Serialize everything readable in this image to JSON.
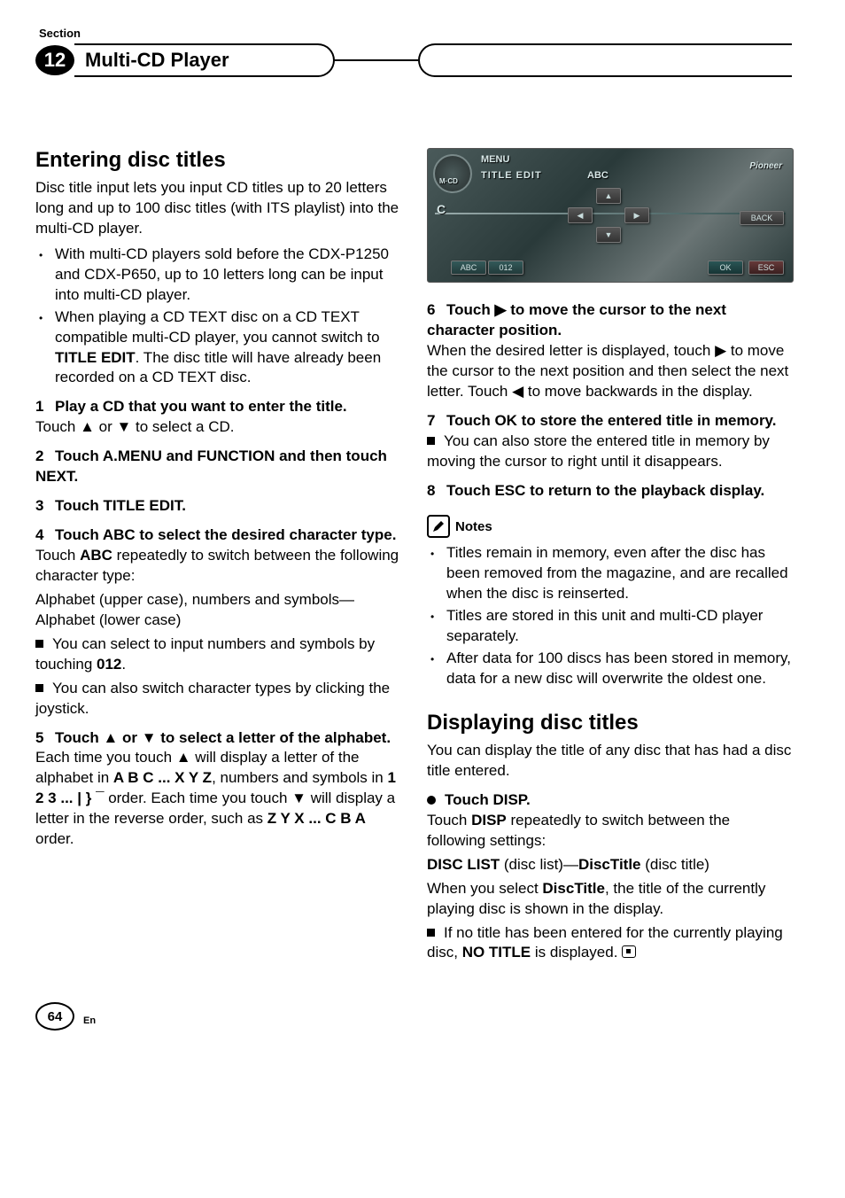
{
  "header": {
    "section_label": "Section",
    "chapter_number": "12",
    "chapter_title": "Multi-CD Player"
  },
  "screenshot": {
    "menu": "MENU",
    "title_edit": "TITLE EDIT",
    "abc_top": "ABC",
    "brand": "Pioneer",
    "text_c": "C",
    "back": "BACK",
    "abc_btn": "ABC",
    "num_btn": "012",
    "ok": "OK",
    "esc": "ESC"
  },
  "left": {
    "h1": "Entering disc titles",
    "intro": "Disc title input lets you input CD titles up to 20 letters long and up to 100 disc titles (with ITS playlist) into the multi-CD player.",
    "bullets": [
      "With multi-CD players sold before the CDX-P1250 and CDX-P650, up to 10 letters long can be input into multi-CD player.",
      ""
    ],
    "bullet2_part1": "When playing a CD TEXT disc on a CD TEXT compatible multi-CD player, you cannot switch to ",
    "bullet2_strong": "TITLE EDIT",
    "bullet2_part2": ". The disc title will have already been recorded on a CD TEXT disc.",
    "step1": "Play a CD that you want to enter the title.",
    "step1_sub": "Touch ▲ or ▼ to select a CD.",
    "step2": "Touch A.MENU and FUNCTION and then touch NEXT.",
    "step3": "Touch TITLE EDIT.",
    "step4": "Touch ABC to select the desired character type.",
    "step4_sub1_a": "Touch ",
    "step4_sub1_b": "ABC",
    "step4_sub1_c": " repeatedly to switch between the following character type:",
    "step4_sub2": "Alphabet (upper case), numbers and symbols—Alphabet (lower case)",
    "step4_note1_a": "You can select to input numbers and symbols by touching ",
    "step4_note1_b": "012",
    "step4_note1_c": ".",
    "step4_note2": "You can also switch character types by clicking the joystick.",
    "step5": "Touch ▲ or ▼ to select a letter of the alphabet.",
    "step5_sub_a": "Each time you touch ▲ will display a letter of the alphabet in ",
    "step5_sub_b": "A B C ... X Y Z",
    "step5_sub_c": ", numbers and symbols in ",
    "step5_sub_d": "1 2 3 ... | } ¯",
    "step5_sub_e": " order. Each time you touch ▼ will display a letter in the reverse order, such as ",
    "step5_sub_f": "Z Y X ... C B A",
    "step5_sub_g": " order."
  },
  "right": {
    "step6": "Touch ▶ to move the cursor to the next character position.",
    "step6_sub": "When the desired letter is displayed, touch ▶ to move the cursor to the next position and then select the next letter. Touch ◀ to move backwards in the display.",
    "step7": "Touch OK to store the entered title in memory.",
    "step7_note": "You can also store the entered title in memory by moving the cursor to right until it disappears.",
    "step8": "Touch ESC to return to the playback display.",
    "notes_label": "Notes",
    "notes": [
      "Titles remain in memory, even after the disc has been removed from the magazine, and are recalled when the disc is reinserted.",
      "Titles are stored in this unit and multi-CD player separately.",
      "After data for 100 discs has been stored in memory, data for a new disc will overwrite the oldest one."
    ],
    "h2": "Displaying disc titles",
    "h2_intro": "You can display the title of any disc that has had a disc title entered.",
    "disp_step": "Touch DISP.",
    "disp_sub1_a": "Touch ",
    "disp_sub1_b": "DISP",
    "disp_sub1_c": " repeatedly to switch between the following settings:",
    "disp_sub2_a": "DISC LIST",
    "disp_sub2_b": " (disc list)—",
    "disp_sub2_c": "DiscTitle",
    "disp_sub2_d": " (disc title)",
    "disp_sub3_a": "When you select ",
    "disp_sub3_b": "DiscTitle",
    "disp_sub3_c": ", the title of the currently playing disc is shown in the display.",
    "disp_note_a": "If no title has been entered for the currently playing disc, ",
    "disp_note_b": "NO TITLE",
    "disp_note_c": " is displayed."
  },
  "footer": {
    "page": "64",
    "lang": "En"
  }
}
